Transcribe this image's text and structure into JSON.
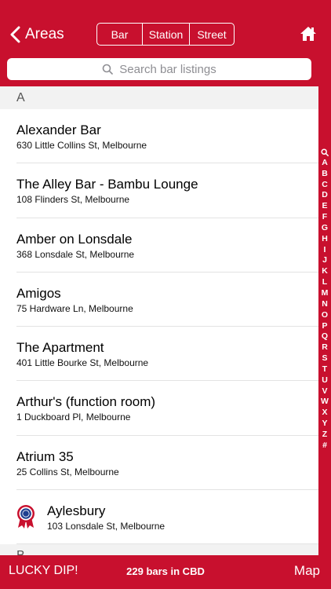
{
  "header": {
    "back_label": "Areas",
    "segments": [
      "Bar",
      "Station",
      "Street"
    ],
    "home_icon": "home-icon"
  },
  "search": {
    "placeholder": "Search bar listings"
  },
  "sections": [
    {
      "letter": "A",
      "bars": [
        {
          "name": "Alexander Bar",
          "address": "630 Little Collins St, Melbourne"
        },
        {
          "name": "The Alley Bar - Bambu Lounge",
          "address": "108 Flinders St, Melbourne"
        },
        {
          "name": "Amber on Lonsdale",
          "address": "368 Lonsdale St, Melbourne"
        },
        {
          "name": "Amigos",
          "address": "75 Hardware Ln, Melbourne"
        },
        {
          "name": "The Apartment",
          "address": "401 Little Bourke St, Melbourne"
        },
        {
          "name": "Arthur's (function room)",
          "address": "1 Duckboard Pl, Melbourne"
        },
        {
          "name": "Atrium 35",
          "address": "25 Collins St, Melbourne"
        },
        {
          "name": "Aylesbury",
          "address": "103 Lonsdale St, Melbourne",
          "badge": "award-ribbon-icon"
        }
      ]
    },
    {
      "letter": "B",
      "bars": []
    }
  ],
  "index_letters": [
    "A",
    "B",
    "C",
    "D",
    "E",
    "F",
    "G",
    "H",
    "I",
    "J",
    "K",
    "L",
    "M",
    "N",
    "O",
    "P",
    "Q",
    "R",
    "S",
    "T",
    "U",
    "V",
    "W",
    "X",
    "Y",
    "Z",
    "#"
  ],
  "footer": {
    "lucky_label": "LUCKY DIP!",
    "count_label": "229 bars in CBD",
    "map_label": "Map"
  },
  "colors": {
    "brand": "#c8102e",
    "section_bg": "#f2f2f2",
    "badge_blue": "#1f3f8f"
  }
}
